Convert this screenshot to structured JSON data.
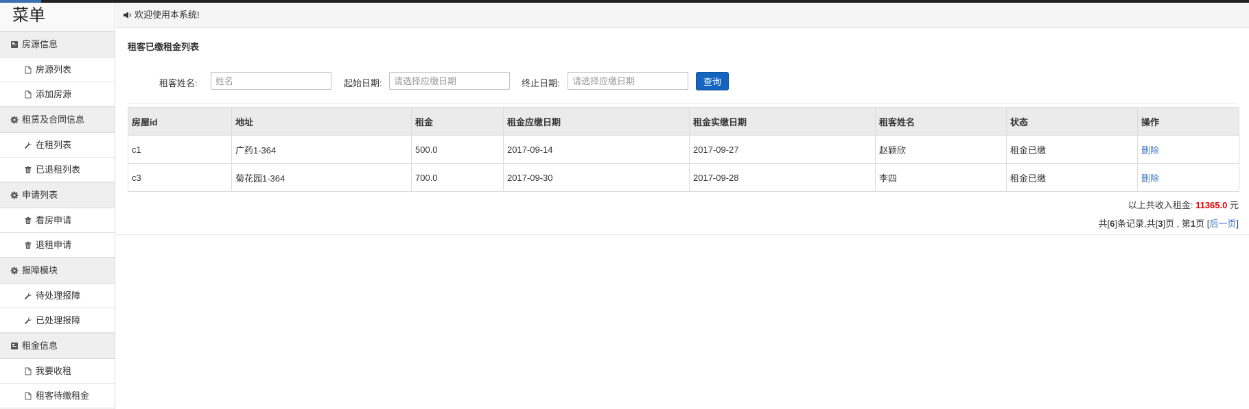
{
  "sidebar": {
    "title": "菜单",
    "groups": [
      {
        "label": "房源信息",
        "icon": "book-icon",
        "items": [
          {
            "label": "房源列表",
            "icon": "file-icon"
          },
          {
            "label": "添加房源",
            "icon": "file-icon"
          }
        ]
      },
      {
        "label": "租赁及合同信息",
        "icon": "gear-icon",
        "items": [
          {
            "label": "在租列表",
            "icon": "wrench-icon"
          },
          {
            "label": "已退租列表",
            "icon": "trash-icon"
          }
        ]
      },
      {
        "label": "申请列表",
        "icon": "gear-icon",
        "items": [
          {
            "label": "看房申请",
            "icon": "trash-icon"
          },
          {
            "label": "退租申请",
            "icon": "trash-icon"
          }
        ]
      },
      {
        "label": "报障模块",
        "icon": "gear-icon",
        "items": [
          {
            "label": "待处理报障",
            "icon": "wrench-icon"
          },
          {
            "label": "已处理报障",
            "icon": "wrench-icon"
          }
        ]
      },
      {
        "label": "租金信息",
        "icon": "book-icon",
        "items": [
          {
            "label": "我要收租",
            "icon": "file-icon"
          },
          {
            "label": "租客待缴租金",
            "icon": "file-icon"
          }
        ]
      }
    ]
  },
  "header": {
    "welcome": "欢迎使用本系统!",
    "icon": "volume-icon"
  },
  "panel": {
    "title": "租客已缴租金列表"
  },
  "search": {
    "name_label": "租客姓名:",
    "name_placeholder": "姓名",
    "start_label": "起始日期:",
    "start_placeholder": "请选择应缴日期",
    "end_label": "终止日期:",
    "end_placeholder": "请选择应缴日期",
    "button": "查询"
  },
  "table": {
    "columns": [
      "房屋id",
      "地址",
      "租金",
      "租金应缴日期",
      "租金实缴日期",
      "租客姓名",
      "状态",
      "操作"
    ],
    "rows": [
      [
        "c1",
        "广药1-364",
        "500.0",
        "2017-09-14",
        "2017-09-27",
        "赵颖欣",
        "租金已缴",
        "删除"
      ],
      [
        "c3",
        "菊花园1-364",
        "700.0",
        "2017-09-30",
        "2017-09-28",
        "李四",
        "租金已缴",
        "删除"
      ]
    ]
  },
  "summary": {
    "label": "以上共收入租金:",
    "amount": "11365.0",
    "unit": "元",
    "amount_color": "#e60000"
  },
  "pager": {
    "p1": "共[",
    "records": "6",
    "p2": "]条记录,共[",
    "pages": "3",
    "p3": "]页 , 第",
    "current": "1",
    "p4": "页 [",
    "next": "后一页",
    "p5": "]"
  },
  "colors": {
    "primary_button": "#1565c0",
    "link": "#3b76c4"
  }
}
